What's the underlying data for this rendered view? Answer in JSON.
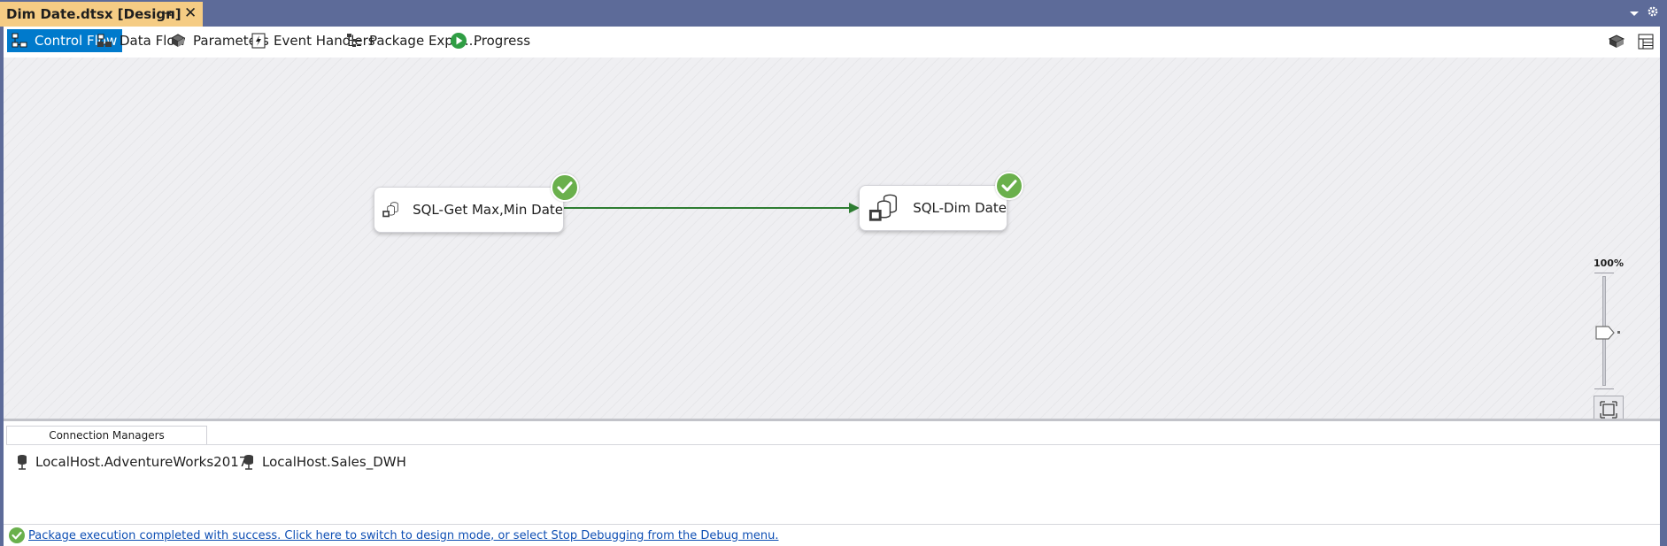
{
  "document_tab": {
    "title": "Dim Date.dtsx [Design]",
    "pin_icon": "pin-icon",
    "close_icon": "close-icon",
    "close_glyph": "✕"
  },
  "toolbar": {
    "tabs": [
      {
        "label": "Control Flow",
        "icon": "control-flow-icon",
        "active": true
      },
      {
        "label": "Data Flow",
        "icon": "data-flow-icon",
        "active": false
      },
      {
        "label": "Parameters",
        "icon": "parameters-icon",
        "active": false
      },
      {
        "label": "Event Handlers",
        "icon": "event-handlers-icon",
        "active": false
      },
      {
        "label": "Package Explo...",
        "icon": "package-explorer-icon",
        "active": false
      },
      {
        "label": "Progress",
        "icon": "progress-icon",
        "active": false
      }
    ]
  },
  "canvas": {
    "tasks": [
      {
        "name": "SQL-Get Max,Min Date",
        "status": "success"
      },
      {
        "name": "SQL-Dim Date",
        "status": "success"
      }
    ],
    "precedence_constraint": {
      "from": "SQL-Get Max,Min Date",
      "to": "SQL-Dim Date",
      "color": "#2e7d32"
    },
    "zoom": {
      "label": "100%"
    }
  },
  "connection_managers": {
    "tab_label": "Connection Managers",
    "items": [
      {
        "name": "LocalHost.AdventureWorks2017",
        "icon": "database-connection-icon"
      },
      {
        "name": "LocalHost.Sales_DWH",
        "icon": "database-connection-icon"
      }
    ]
  },
  "status_bar": {
    "message": "Package execution completed with success. Click here to switch to design mode, or select Stop Debugging from the Debug menu.",
    "icon": "success-check-icon"
  },
  "colors": {
    "chrome": "#5d6b99",
    "active_tab": "#f5cc84",
    "accent": "#007acc",
    "success": "#6ab04c",
    "link": "#0e4fb4"
  }
}
